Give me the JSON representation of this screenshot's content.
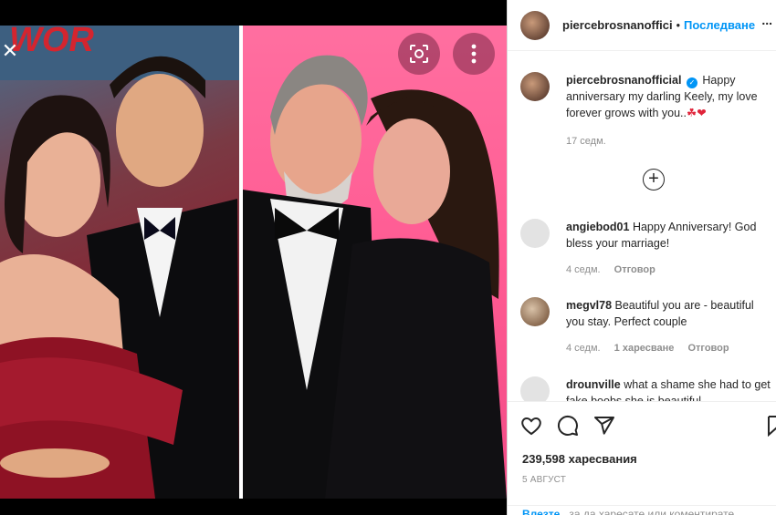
{
  "header": {
    "username": "piercebrosnanoffici",
    "separator": "•",
    "follow_label": "Последване",
    "more_label": "..."
  },
  "media": {
    "close_icon": "close-icon",
    "lens_icon": "visual-search-icon",
    "more_icon": "more-vertical-icon"
  },
  "caption": {
    "username": "piercebrosnanofficial",
    "text": "Happy anniversary my darling Keely, my love forever grows with you..",
    "emojis": "☘❤",
    "time": "17 седм."
  },
  "load_more_icon": "plus-circle-icon",
  "comments": [
    {
      "username": "angiebod01",
      "text": "Happy Anniversary! God bless your marriage!",
      "time": "4 седм.",
      "reply": "Отговор",
      "likes": ""
    },
    {
      "username": "megvl78",
      "text": "Beautiful you are - beautiful you stay. Perfect couple",
      "time": "4 седм.",
      "likes": "1 харесване",
      "reply": "Отговор"
    },
    {
      "username": "drounville",
      "text": "what a shame she had to get fake boobs she is beautiful",
      "time": "",
      "reply": "",
      "likes": ""
    }
  ],
  "actions": {
    "like_icon": "heart-icon",
    "comment_icon": "comment-icon",
    "share_icon": "share-icon",
    "save_icon": "bookmark-icon",
    "likes": "239,598 харесвания",
    "date": "5 АВГУСТ"
  },
  "login": {
    "link": "Влезте",
    "text": " , за да харесате или коментирате"
  },
  "colors": {
    "accent": "#0095f6",
    "heart": "#ed4956",
    "clover": "#2e9e3e"
  }
}
